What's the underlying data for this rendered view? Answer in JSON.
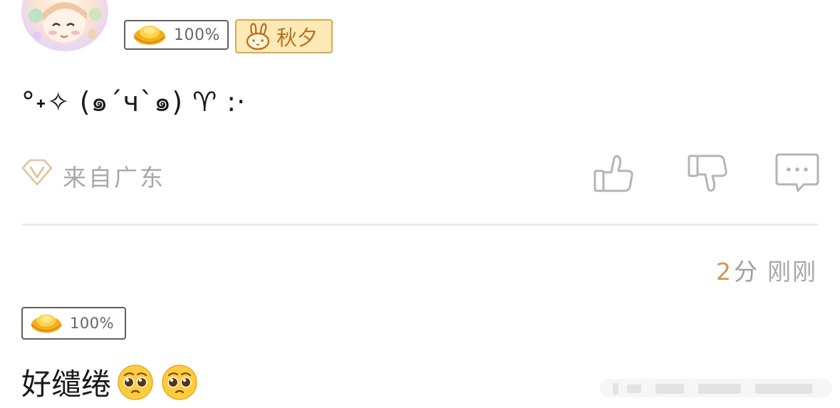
{
  "comment1": {
    "gold_badge_percent": "100%",
    "user_badge_name": "秋夕",
    "text": "°˖✧ (๑´ч`๑) ♈︎ :·",
    "location": "来自广东",
    "icons": [
      "thumbs-up-icon",
      "thumbs-down-icon",
      "reply-icon"
    ]
  },
  "comment2": {
    "score_value": "2",
    "score_unit": "分",
    "time": "刚刚",
    "gold_badge_percent": "100%",
    "text": "好缱绻",
    "emoji": "pleading-face-icon"
  },
  "colors": {
    "accent_orange": "#d4954a",
    "badge_bg": "#fde9b6",
    "badge_border": "#d8a858",
    "muted_text": "#a8a8a8"
  }
}
